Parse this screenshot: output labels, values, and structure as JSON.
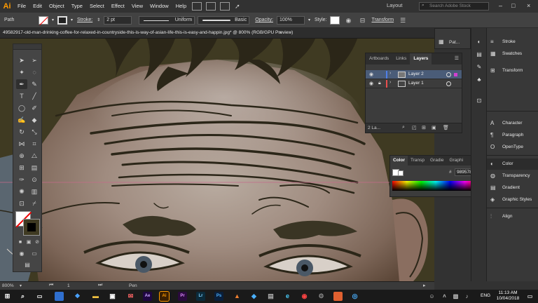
{
  "app": {
    "logo": "Ai",
    "workspace": "Layout",
    "search_placeholder": "Search Adobe Stock"
  },
  "menus": [
    "File",
    "Edit",
    "Object",
    "Type",
    "Select",
    "Effect",
    "View",
    "Window",
    "Help"
  ],
  "control_bar": {
    "object_label": "Path",
    "stroke_label": "Stroke:",
    "stroke_weight": "2 pt",
    "profile": "Uniform",
    "brush": "Basic",
    "opacity_label": "Opacity:",
    "opacity_value": "100%",
    "style_label": "Style:",
    "transform_label": "Transform"
  },
  "document": {
    "tab_title": "49582917-old-man-drinking-coffee-for-relaxed-in-countryside-this-is-way-of-asian-life-this-is-easy-and-happin.jpg* @ 800% (RGB/GPU Preview)",
    "close_glyph": "×"
  },
  "status_bar": {
    "zoom": "800%",
    "artboard": "1",
    "tool": "Pen"
  },
  "layers_panel": {
    "tabs": [
      "Artboards",
      "Links",
      "Layers"
    ],
    "active_tab": "Layers",
    "layers": [
      {
        "name": "Layer 2",
        "color": "#4f7fe8",
        "selected": true,
        "locked": false
      },
      {
        "name": "Layer 1",
        "color": "#e84f4f",
        "selected": false,
        "locked": true
      }
    ],
    "count": "2 La..."
  },
  "color_panel": {
    "tabs": [
      "Color",
      "Transp",
      "Gradie",
      "Graphi"
    ],
    "active_tab": "Color",
    "hex": "989578"
  },
  "dock_mini": {
    "label": "Pat..."
  },
  "dock": {
    "items": [
      {
        "label": "Stroke",
        "icon": "stroke-icon",
        "glyph": "≡"
      },
      {
        "label": "Swatches",
        "icon": "swatches-icon",
        "glyph": "▦"
      },
      {
        "label": "Transform",
        "icon": "transform-icon",
        "glyph": "⊞"
      },
      {
        "label": "Character",
        "icon": "character-icon",
        "glyph": "A"
      },
      {
        "label": "Paragraph",
        "icon": "paragraph-icon",
        "glyph": "¶"
      },
      {
        "label": "OpenType",
        "icon": "opentype-icon",
        "glyph": "O"
      },
      {
        "label": "Color",
        "icon": "color-icon",
        "glyph": "◐"
      },
      {
        "label": "Transparency",
        "icon": "transparency-icon",
        "glyph": "◍"
      },
      {
        "label": "Gradient",
        "icon": "gradient-icon",
        "glyph": "▤"
      },
      {
        "label": "Graphic Styles",
        "icon": "graphic-styles-icon",
        "glyph": "◈"
      },
      {
        "label": "Align",
        "icon": "align-icon",
        "glyph": "⫶"
      }
    ]
  },
  "taskbar": {
    "apps": [
      {
        "icon": "ae-icon",
        "text": "Ae",
        "color": "#1f0740"
      },
      {
        "icon": "ai-icon",
        "text": "Ai",
        "color": "#ff7c00"
      },
      {
        "icon": "pr-icon",
        "text": "Pr",
        "color": "#2a0a3d"
      },
      {
        "icon": "lr-icon",
        "text": "Lr",
        "color": "#0b2a3a"
      },
      {
        "icon": "ps-icon",
        "text": "Ps",
        "color": "#0a1f3a"
      }
    ],
    "lang": "ENG",
    "time": "11:13 AM",
    "date": "10/04/2018"
  }
}
